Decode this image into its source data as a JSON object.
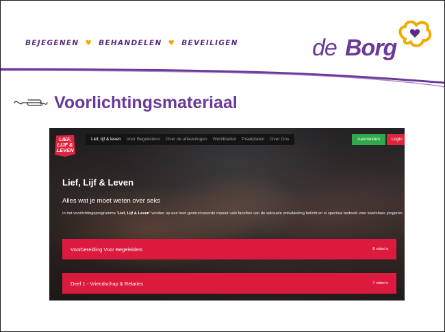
{
  "header": {
    "tagline_parts": [
      "BEJEGENEN",
      "BEHANDELEN",
      "BEVEILIGEN"
    ],
    "heart_glyph": "♥",
    "logo_prefix": "de",
    "logo_name": "Borg",
    "colors": {
      "purple": "#6a3a9a",
      "gold": "#f2a900"
    }
  },
  "slide": {
    "title": "Voorlichtingsmateriaal",
    "ornament_icon": "hand-ornament-icon"
  },
  "website": {
    "logo_text": [
      "LIEF,",
      "LIJF &",
      "LEVEN"
    ],
    "nav": [
      "Lief, lijf & leven",
      "Voor Begeleiders",
      "Over de afleveringen",
      "Werkbladen",
      "Praatplaten",
      "Over Ons"
    ],
    "active_nav_index": 0,
    "register_label": "Aanmelden",
    "login_label": "Login",
    "hero_title": "Lief, Lijf & Leven",
    "hero_subtitle": "Alles wat je moet weten over seks",
    "intro_before": "In het voorlichtingsprogramma ",
    "intro_bold": "'Lief, Lijf & Leven'",
    "intro_after": " worden op een heel gestructureerde manier vele facetten van de seksuele ontwikkeling belicht en is speciaal bedoeld voor kwetsbare jongeren.",
    "series": [
      {
        "title": "Voorbereiding Voor Begeleiders",
        "count": "8 video's"
      },
      {
        "title": "Deel 1 - Vriendschap & Relaties",
        "count": "7 video's"
      }
    ],
    "colors": {
      "series_red": "#dc1a3e",
      "register_green": "#2eaa4a",
      "login_red": "#e0243d"
    }
  }
}
